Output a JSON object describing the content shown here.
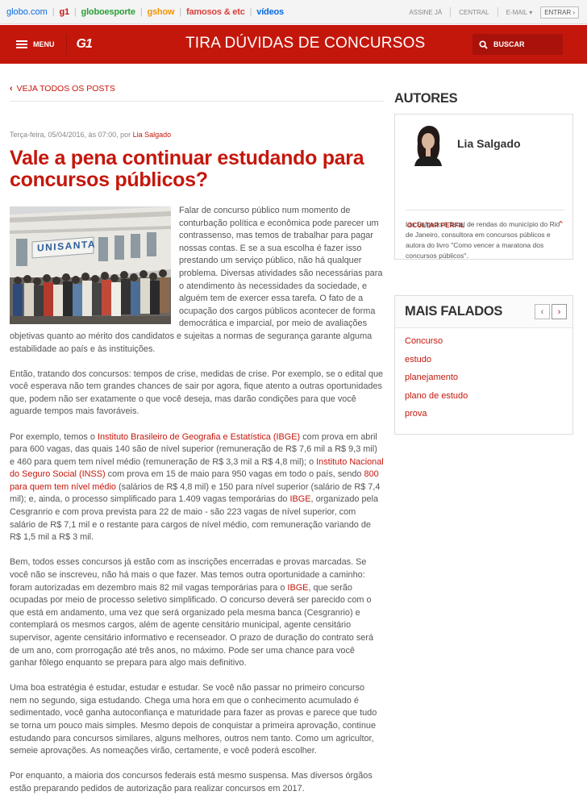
{
  "topbar": {
    "links": [
      "globo.com",
      "g1",
      "globoesporte",
      "gshow",
      "famosos & etc",
      "vídeos"
    ],
    "subscribe": "ASSINE JÁ",
    "central": "CENTRAL",
    "email": "E-MAIL",
    "enter": "ENTRAR"
  },
  "header": {
    "menu_label": "MENU",
    "logo": "G1",
    "section_title": "TIRA DÚVIDAS DE CONCURSOS",
    "search_label": "BUSCAR"
  },
  "main": {
    "back_label": "VEJA TODOS OS POSTS",
    "meta_date": "Terça-feira, 05/04/2016, às 07:00, por",
    "meta_author": "Lia Salgado",
    "title": "Vale a pena continuar estudando para concursos públicos?",
    "image_sign": "UNISANTA",
    "p1": "Falar de concurso público num momento de conturbação política e econômica pode parecer um contrassenso, mas temos de trabalhar para pagar nossas contas. E se a sua escolha é fazer isso prestando um serviço público, não há qualquer problema. Diversas atividades são necessárias para o atendimento às necessidades da sociedade, e alguém tem de exercer essa tarefa. O fato de a ocupação dos cargos públicos acontecer de forma democrática e imparcial, por meio de avaliações objetivas quanto ao mérito dos candidatos e sujeitas a normas de segurança garante alguma estabilidade ao país e às instituições.",
    "p2": "Então, tratando dos concursos: tempos de crise, medidas de crise. Por exemplo, se o edital que você esperava não tem grandes chances de sair por agora, fique atento a outras oportunidades que, podem não ser exatamente o que você deseja, mas darão condições para que você aguarde tempos mais favoráveis.",
    "p3": {
      "t1": "Por exemplo, temos o ",
      "l1": "Instituto Brasileiro de Geografia e Estatística (IBGE)",
      "t2": " com prova em abril para 600 vagas, das quais 140 são de nível superior (remuneração de R$ 7,6 mil a R$ 9,3 mil) e  460 para quem tem nível médio (remuneração de R$ 3,3 mil a R$ 4,8 mil); o ",
      "l2": "Instituto Nacional do Seguro Social (INSS)",
      "t3": " com prova em 15 de maio para 950 vagas em todo o país, sendo ",
      "l3": "800 para quem tem nível médio",
      "t4": "  (salários de R$ 4,8 mil) e 150 para nível superior (salário de R$ 7,4 mil); e, ainda, o processo simplificado para 1.409 vagas temporárias do ",
      "l4": "IBGE",
      "t5": ", organizado pela Cesgranrio e com prova prevista para 22 de maio - são 223 vagas de nível superior, com salário de R$ 7,1 mil e o restante para cargos de nível médio, com remuneração variando de R$ 1,5 mil a R$ 3 mil."
    },
    "p4": {
      "t1": "Bem, todos esses concursos já estão com as inscrições encerradas e provas marcadas. Se você não se inscreveu, não há mais o que fazer. Mas temos outra oportunidade a caminho: foram autorizadas em dezembro mais 82 mil vagas temporárias para o ",
      "l1": "IBGE",
      "t2": ", que serão ocupadas por meio de processo seletivo simplificado. O concurso deverá ser parecido com o que está em andamento, uma vez que será organizado pela mesma banca (Cesgranrio) e contemplará os mesmos cargos, além de agente censitário municipal, agente censitário supervisor, agente censitário informativo e recenseador. O prazo de duração do contrato será de um ano, com prorrogação até três anos, no máximo. Pode ser uma chance para você ganhar fôlego enquanto se prepara para algo mais definitivo."
    },
    "p5": "Uma boa estratégia é estudar, estudar e estudar. Se você não passar no primeiro concurso nem no segundo, siga estudando. Chega uma hora em que o conhecimento acumulado é sedimentado, você ganha autoconfiança e maturidade para fazer as provas e parece que tudo se torna um pouco mais simples. Mesmo depois de conquistar a primeira aprovação, continue estudando para concursos similares, alguns melhores, outros nem tanto. Como um agricultor, semeie aprovações. As nomeações virão, certamente, e você poderá escolher.",
    "p6": "Por enquanto, a maioria dos concursos federais está mesmo suspensa. Mas diversos órgãos estão preparando pedidos de autorização para realizar concursos em 2017."
  },
  "sidebar": {
    "authors_heading": "AUTORES",
    "author_name": "Lia Salgado",
    "hide_profile": "OCULTAR PERFIL",
    "bio": "Lia Salgado é fiscal de rendas do município do Rio de Janeiro, consultora em concursos públicos e autora do livro \"Como vencer a maratona dos concursos públicos\".",
    "trending_heading": "MAIS FALADOS",
    "trending": [
      "Concurso",
      "estudo",
      "planejamento",
      "plano de estudo",
      "prova"
    ]
  },
  "colors": {
    "brand": "#c4170c",
    "header": "#c4170c",
    "text": "#555555"
  }
}
